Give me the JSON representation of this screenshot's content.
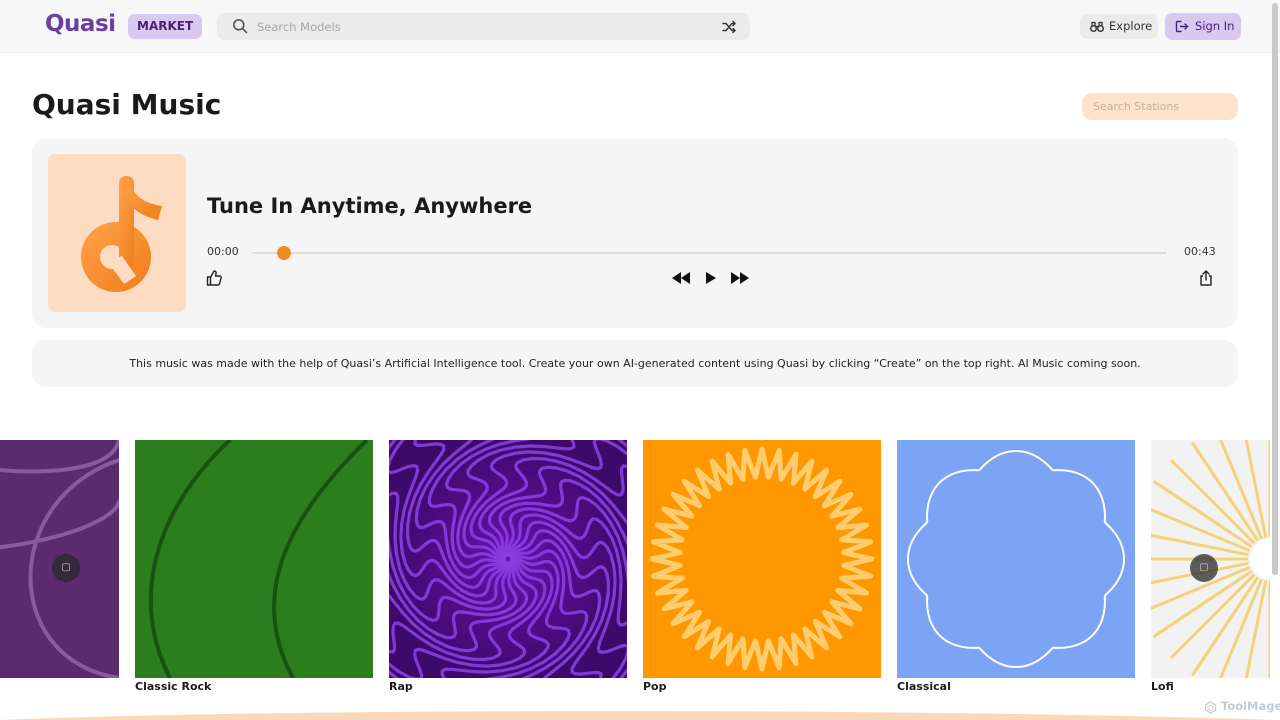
{
  "header": {
    "logo": "Quasi",
    "market_badge": "MARKET",
    "search_placeholder": "Search Models",
    "explore_label": "Explore",
    "signin_label": "Sign In"
  },
  "page": {
    "title": "Quasi Music",
    "station_search_placeholder": "Search Stations"
  },
  "player": {
    "track_title": "Tune In Anytime, Anywhere",
    "current_time": "00:00",
    "duration": "00:43",
    "progress_fraction": 0.0
  },
  "info_text": "This music was made with the help of Quasi’s Artificial Intelligence tool. Create your own AI-generated content using Quasi by clicking “Create” on the top right. AI Music coming soon.",
  "stations": [
    {
      "name": "",
      "color": "#5c2a6e"
    },
    {
      "name": "Classic Rock",
      "color": "#2b7d1e"
    },
    {
      "name": "Rap",
      "color": "#3d0a6b"
    },
    {
      "name": "Pop",
      "color": "#ff9800"
    },
    {
      "name": "Classical",
      "color": "#7ba4f5"
    },
    {
      "name": "Lofi",
      "color": "#f2f2f2"
    }
  ],
  "carousel": {
    "prev_glyph": "▢",
    "next_glyph": "▢"
  },
  "watermark": "ToolMage",
  "colors": {
    "accent": "#f08a24",
    "brand": "#6b3fa0",
    "brand_light": "#d9c8f0"
  }
}
